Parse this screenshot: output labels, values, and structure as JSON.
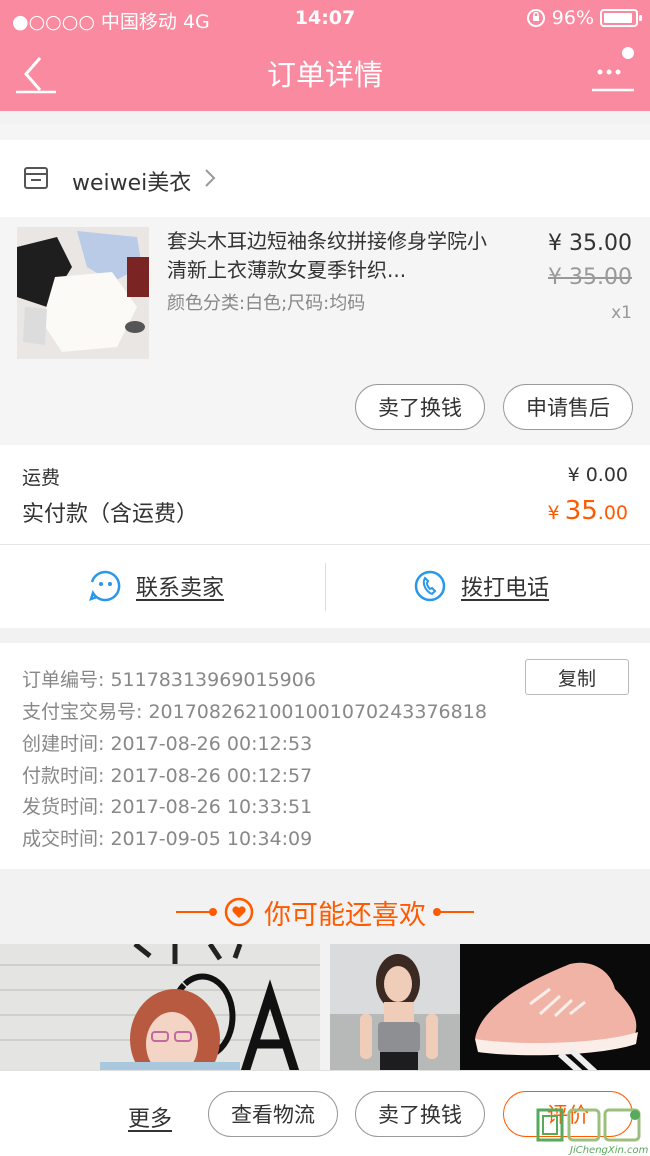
{
  "status_bar": {
    "carrier": "●○○○○ 中国移动  4G",
    "time": "14:07",
    "battery": "96%"
  },
  "nav": {
    "title": "订单详情"
  },
  "shop": {
    "name": "weiwei美衣"
  },
  "product": {
    "title": "套头木耳边短袖条纹拼接修身学院小清新上衣薄款女夏季针织...",
    "sku": "颜色分类:白色;尺码:均码",
    "price": "¥ 35.00",
    "original_price": "¥ 35.00",
    "quantity": "x1",
    "actions": [
      "卖了换钱",
      "申请售后"
    ]
  },
  "fees": {
    "shipping_label": "运费",
    "shipping_value": "¥ 0.00",
    "paid_label": "实付款（含运费）",
    "paid_currency": "¥",
    "paid_integer": "35",
    "paid_decimal": ".00"
  },
  "contact": {
    "seller_label": "联系卖家",
    "phone_label": "拨打电话"
  },
  "order_info": {
    "copy_label": "复制",
    "rows": [
      "订单编号:   51178313969015906",
      "支付宝交易号:   2017082621001001070243376818",
      "创建时间:   2017-08-26 00:12:53",
      "付款时间:   2017-08-26 00:12:57",
      "发货时间:   2017-08-26 10:33:51",
      "成交时间:   2017-09-05 10:34:09"
    ]
  },
  "recommend": {
    "title": "你可能还喜欢"
  },
  "bottom_bar": {
    "more_label": "更多",
    "buttons": [
      "查看物流",
      "卖了换钱",
      "评价"
    ]
  },
  "watermark": {
    "text": "JiChengXin.com",
    "logo_text": "集城信"
  },
  "colors": {
    "header": "#fa8aa0",
    "accent": "#ff5a00",
    "blue": "#2a97e8"
  }
}
